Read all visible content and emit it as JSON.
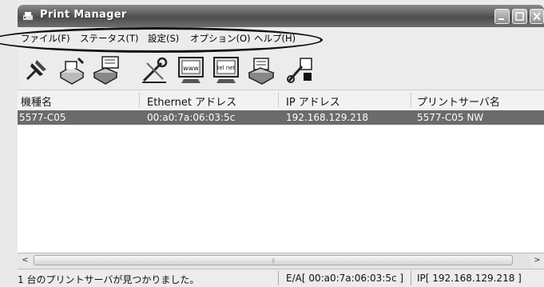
{
  "window": {
    "title": "Print Manager"
  },
  "menu": [
    "ファイル(F)",
    "ステータス(T)",
    "設定(S)",
    "オプション(O)",
    "ヘルプ(H)"
  ],
  "list": {
    "headers": [
      "機種名",
      "Ethernet アドレス",
      "IP アドレス",
      "プリントサーバ名"
    ],
    "rows": [
      [
        "5577-C05",
        "00:a0:7a:06:03:5c",
        "192.168.129.218",
        "5577-C05 NW"
      ]
    ]
  },
  "toolbar": {
    "icons": [
      "pin-icon",
      "printer-settings-icon",
      "printer-network-icon",
      "tools-icon",
      "www-icon",
      "telnet-icon",
      "printer-doc-icon",
      "config-icon"
    ],
    "www_label": "www",
    "telnet_label": "tel net"
  },
  "scrollbar": {
    "left_arrow": "<",
    "right_arrow": ">"
  },
  "status": {
    "message": "1 台のプリントサーバが見つかりました。",
    "ethernet": "E/A[ 00:a0:7a:06:03:5c ]",
    "ip": "IP[ 192.168.129.218 ]"
  }
}
